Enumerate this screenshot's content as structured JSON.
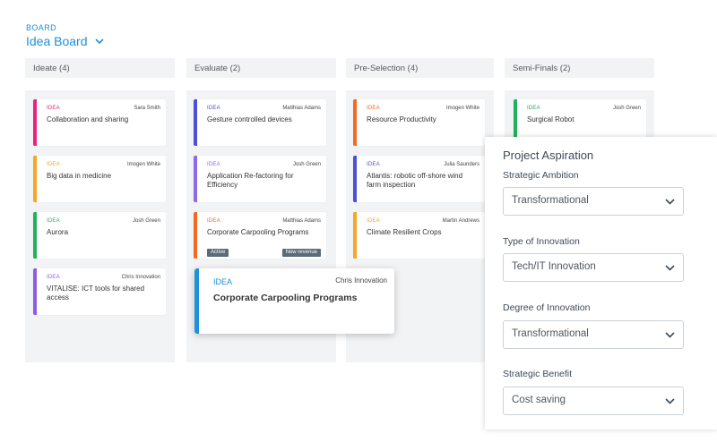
{
  "board": {
    "label": "BOARD",
    "title": "Idea Board"
  },
  "columns": [
    {
      "name": "Ideate (4)",
      "cards": [
        {
          "tag": "IDEA",
          "owner": "Sara Smith",
          "title": "Collaboration and sharing",
          "color": "#e7237c"
        },
        {
          "tag": "IDEA",
          "owner": "Imogen White",
          "title": "Big data in medicine",
          "color": "#f6a527"
        },
        {
          "tag": "IDEA",
          "owner": "Josh Green",
          "title": "Aurora",
          "color": "#23b05a"
        },
        {
          "tag": "IDEA",
          "owner": "Chris Innovation",
          "title": "VITALISE: ICT tools for shared access",
          "color": "#8e5ce3"
        }
      ]
    },
    {
      "name": "Evaluate (2)",
      "cards": [
        {
          "tag": "IDEA",
          "owner": "Matthias Adams",
          "title": "Gesture controlled devices",
          "color": "#4b4fd9"
        },
        {
          "tag": "IDEA",
          "owner": "Josh Green",
          "title": "Application Re-factoring for Efficiency",
          "color": "#8e6ae6"
        },
        {
          "tag": "IDEA",
          "owner": "Matthias Adams",
          "title": "Corporate Carpooling Programs",
          "color": "#f26a21",
          "badges": [
            "Active",
            "New revenue"
          ]
        }
      ]
    },
    {
      "name": "Pre-Selection (4)",
      "cards": [
        {
          "tag": "IDEA",
          "owner": "Imogen White",
          "title": "Resource Productivity",
          "color": "#f26a21"
        },
        {
          "tag": "IDEA",
          "owner": "Julia Saunders",
          "title": "Atlantis: robotic off-shore wind farm inspection",
          "color": "#4b4fd9"
        },
        {
          "tag": "IDEA",
          "owner": "Martin Andrews",
          "title": "Climate Resilient Crops",
          "color": "#f6a527"
        }
      ]
    },
    {
      "name": "Semi-Finals (2)",
      "cards": [
        {
          "tag": "IDEA",
          "owner": "Josh Green",
          "title": "Surgical Robot",
          "color": "#23b05a"
        }
      ]
    }
  ],
  "dragging_card": {
    "tag": "IDEA",
    "owner": "Chris Innovation",
    "title": "Corporate Carpooling Programs",
    "color": "#1f90d9"
  },
  "panel": {
    "title": "Project Aspiration",
    "fields": [
      {
        "label": "Strategic Ambition",
        "value": "Transformational"
      },
      {
        "label": "Type of Innovation",
        "value": "Tech/IT Innovation"
      },
      {
        "label": "Degree of Innovation",
        "value": "Transformational"
      },
      {
        "label": "Strategic Benefit",
        "value": "Cost saving"
      }
    ]
  },
  "icons": {
    "board_dropdown": "chevron-down-icon",
    "select_arrow": "chevron-down-icon"
  },
  "colors": {
    "accent": "#1f90d9",
    "column_bg": "#f2f3f5",
    "badge_bg": "#5b6b78"
  }
}
